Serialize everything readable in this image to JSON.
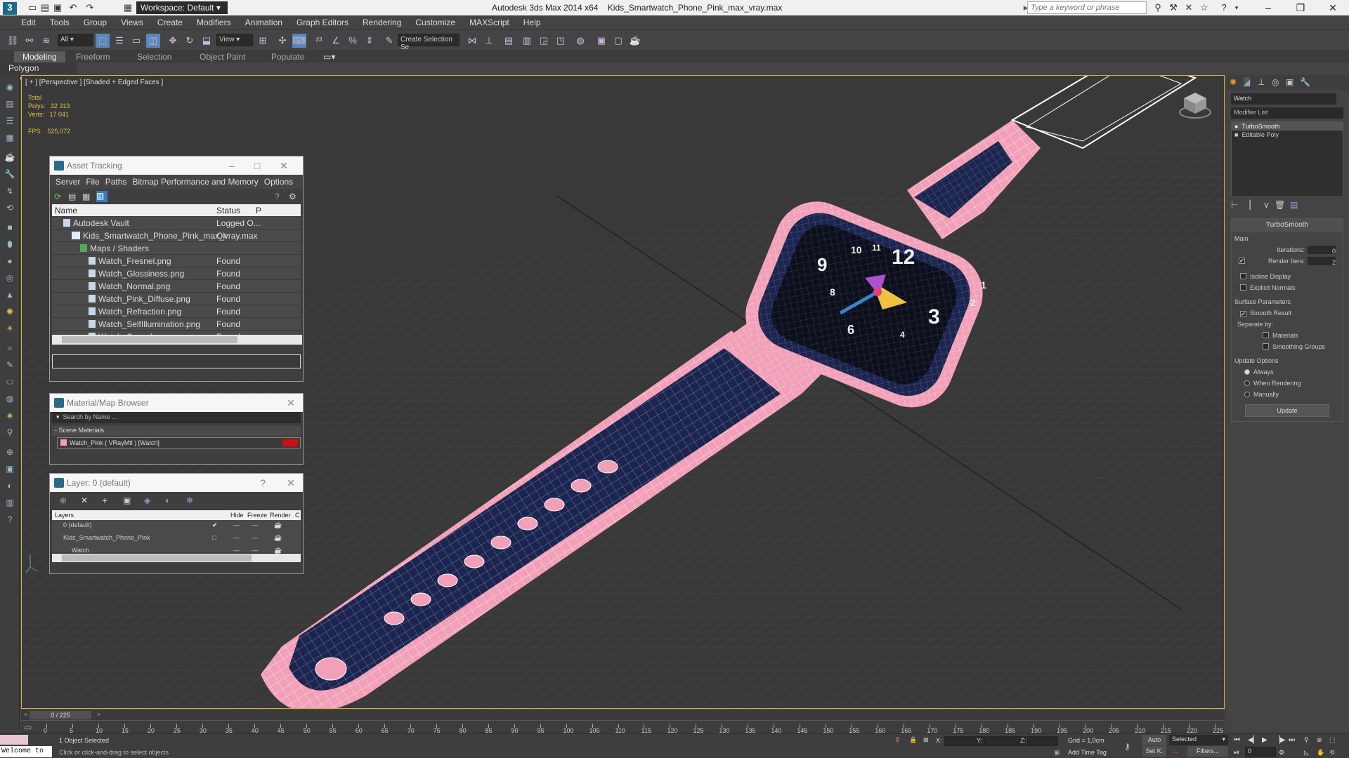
{
  "app": {
    "title": "Autodesk 3ds Max  2014 x64",
    "file": "Kids_Smartwatch_Phone_Pink_max_vray.max",
    "workspace": "Workspace: Default",
    "search_placeholder": "Type a keyword or phrase"
  },
  "menu": [
    "Edit",
    "Tools",
    "Group",
    "Views",
    "Create",
    "Modifiers",
    "Animation",
    "Graph Editors",
    "Rendering",
    "Customize",
    "MAXScript",
    "Help"
  ],
  "toolbar": {
    "selection_filter": "All",
    "ref_coord": "View",
    "named_selection": "Create Selection Se"
  },
  "ribbon": {
    "tabs": [
      "Modeling",
      "Freeform",
      "Selection",
      "Object Paint",
      "Populate"
    ],
    "active": "Modeling",
    "sub": "Polygon Modeling"
  },
  "viewport": {
    "label": "[ + ] [Perspective ] [Shaded + Edged Faces ]",
    "stats": {
      "total_label": "Total",
      "polys_label": "Polys:",
      "polys": "32 313",
      "verts_label": "Verts:",
      "verts": "17 041",
      "fps_label": "FPS:",
      "fps": "525,072"
    },
    "watch_face_numbers": [
      "12",
      "1",
      "2",
      "3",
      "4",
      "6",
      "8",
      "9",
      "10",
      "11"
    ]
  },
  "asset_tracking": {
    "title": "Asset Tracking",
    "menu": [
      "Server",
      "File",
      "Paths",
      "Bitmap Performance and Memory",
      "Options"
    ],
    "columns": [
      "Name",
      "Status",
      "P"
    ],
    "rows": [
      {
        "name": "Autodesk Vault",
        "status": "Logged O..."
      },
      {
        "name": "Kids_Smartwatch_Phone_Pink_max_vray.max",
        "status": "Ok"
      },
      {
        "name": "Maps / Shaders",
        "status": ""
      },
      {
        "name": "Watch_Fresnel.png",
        "status": "Found"
      },
      {
        "name": "Watch_Glossiness.png",
        "status": "Found"
      },
      {
        "name": "Watch_Normal.png",
        "status": "Found"
      },
      {
        "name": "Watch_Pink_Diffuse.png",
        "status": "Found"
      },
      {
        "name": "Watch_Refraction.png",
        "status": "Found"
      },
      {
        "name": "Watch_SelfIllumination.png",
        "status": "Found"
      },
      {
        "name": "Watch_Specular.png",
        "status": "Found"
      }
    ]
  },
  "material_browser": {
    "title": "Material/Map Browser",
    "search_placeholder": "Search by Name ...",
    "group": "- Scene Materials",
    "item": "Watch_Pink  ( VRayMtl )  [Watch]"
  },
  "layer": {
    "title": "Layer: 0 (default)",
    "columns": [
      "Layers",
      "Hide",
      "Freeze",
      "Render",
      "C"
    ],
    "rows": [
      {
        "name": "0 (default)"
      },
      {
        "name": "Kids_Smartwatch_Phone_Pink"
      },
      {
        "name": "Watch"
      }
    ]
  },
  "command_panel": {
    "object_name": "Watch",
    "modifier_list": "Modifier List",
    "stack": [
      "TurboSmooth",
      "Editable Poly"
    ],
    "rollout_title": "TurboSmooth",
    "main": "Main",
    "iterations_label": "Iterations:",
    "iterations": "0",
    "render_iters_label": "Render Iters:",
    "render_iters": "2",
    "isoline": "Isoline Display",
    "explicit_normals": "Explicit Normals",
    "surface_params": "Surface Parameters",
    "smooth_result": "Smooth Result",
    "separate_by": "Separate by:",
    "materials": "Materials",
    "smoothing_groups": "Smoothing Groups",
    "update_options": "Update Options",
    "always": "Always",
    "when_rendering": "When Rendering",
    "manually": "Manually",
    "update_button": "Update"
  },
  "timeline": {
    "frame": "0 / 225",
    "ticks": [
      "0",
      "5",
      "10",
      "15",
      "20",
      "25",
      "30",
      "35",
      "40",
      "45",
      "50",
      "55",
      "60",
      "65",
      "70",
      "75",
      "80",
      "85",
      "90",
      "95",
      "100",
      "105",
      "110",
      "115",
      "120",
      "125",
      "130",
      "135",
      "140",
      "145",
      "150",
      "155",
      "160",
      "165",
      "170",
      "175",
      "180",
      "185",
      "190",
      "195",
      "200",
      "205",
      "210",
      "215",
      "220",
      "225"
    ]
  },
  "status": {
    "welcome": "Welcome to",
    "selected": "1 Object Selected",
    "hint": "Click or click-and-drag to select objects",
    "x_label": "X:",
    "y_label": "Y:",
    "z_label": "Z:",
    "grid": "Grid = 1,0cm",
    "add_time_tag": "Add Time Tag",
    "auto": "Auto",
    "set_key": "Set K.",
    "selected_dropdown": "Selected",
    "filters": "Filters...",
    "frame_field": "0"
  },
  "colors": {
    "strap_pink": "#f2a0b8",
    "strap_navy": "#1b2550",
    "viewport_bg": "#3a3a3a",
    "accent_yellow": "#e0c050"
  }
}
